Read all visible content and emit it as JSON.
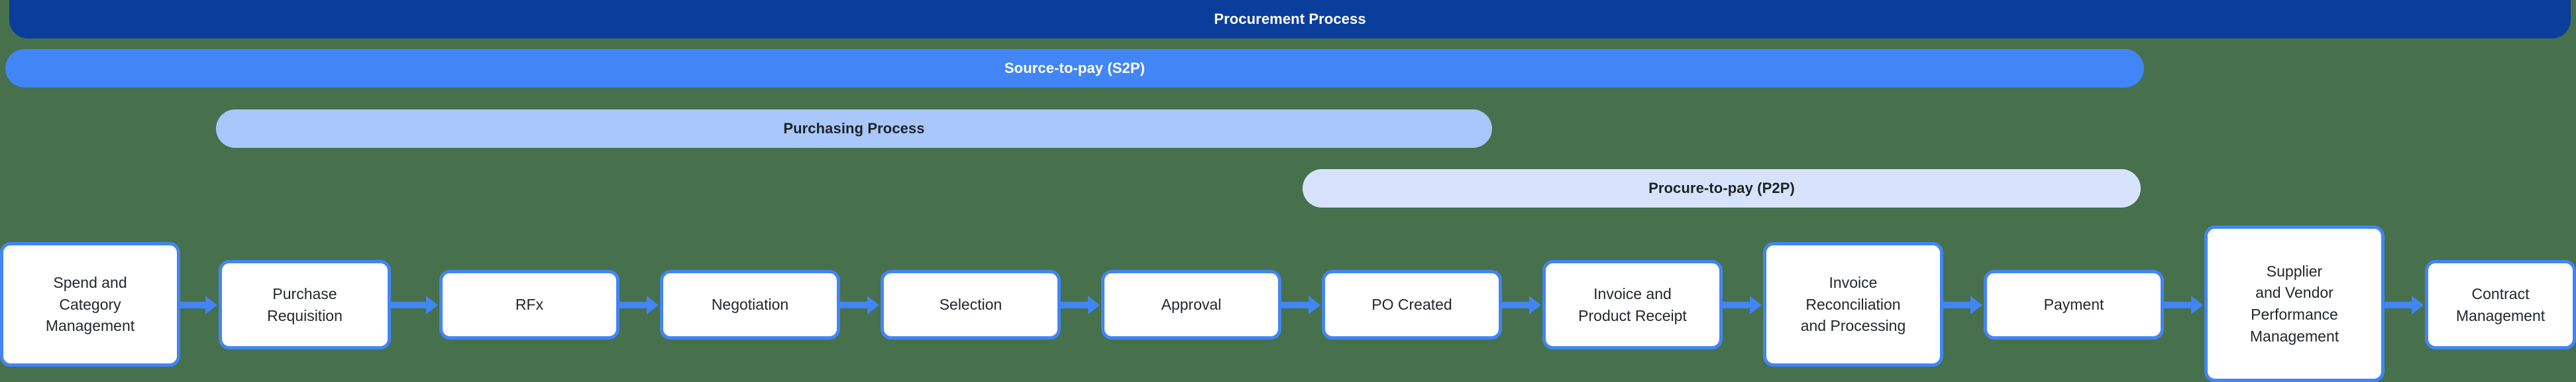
{
  "diagram": {
    "title": "Procurement Process",
    "background_color": "#47704d"
  },
  "colors": {
    "procurement_bar": "#0b3e9b",
    "s2p_bar": "#4285f4",
    "purchasing_bar": "#a8c7fa",
    "p2p_bar": "#d7e3fc",
    "box_border": "#4285f4",
    "box_fill": "#ffffff",
    "arrow": "#4285f4",
    "dark_text": "#23272b",
    "light_text": "#ffffff"
  },
  "phases": [
    {
      "id": "procurement-process",
      "label": "Procurement Process",
      "text_color": "#ffffff",
      "fill": "#0b3e9b"
    },
    {
      "id": "source-to-pay",
      "label": "Source-to-pay (S2P)",
      "text_color": "#ffffff",
      "fill": "#4285f4"
    },
    {
      "id": "purchasing-process",
      "label": "Purchasing Process",
      "text_color": "#1f2326",
      "fill": "#a8c7fa"
    },
    {
      "id": "procure-to-pay",
      "label": "Procure-to-pay (P2P)",
      "text_color": "#1f2326",
      "fill": "#d7e3fc"
    }
  ],
  "steps": [
    {
      "id": "spend-and-category-management",
      "label": "Spend and\nCategory\nManagement",
      "order": 1
    },
    {
      "id": "purchase-requisition",
      "label": "Purchase\nRequisition",
      "order": 2
    },
    {
      "id": "rfx",
      "label": "RFx",
      "order": 3
    },
    {
      "id": "negotiation",
      "label": "Negotiation",
      "order": 4
    },
    {
      "id": "selection",
      "label": "Selection",
      "order": 5
    },
    {
      "id": "approval",
      "label": "Approval",
      "order": 6
    },
    {
      "id": "po-created",
      "label": "PO Created",
      "order": 7
    },
    {
      "id": "invoice-and-product-receipt",
      "label": "Invoice and\nProduct Receipt",
      "order": 8
    },
    {
      "id": "invoice-reconciliation-and-processing",
      "label": "Invoice\nReconciliation\nand Processing",
      "order": 9
    },
    {
      "id": "payment",
      "label": "Payment",
      "order": 10
    },
    {
      "id": "supplier-and-vendor-performance-management",
      "label": "Supplier\nand Vendor\nPerformance\nManagement",
      "order": 11
    },
    {
      "id": "contract-management",
      "label": "Contract\nManagement",
      "order": 12
    }
  ]
}
